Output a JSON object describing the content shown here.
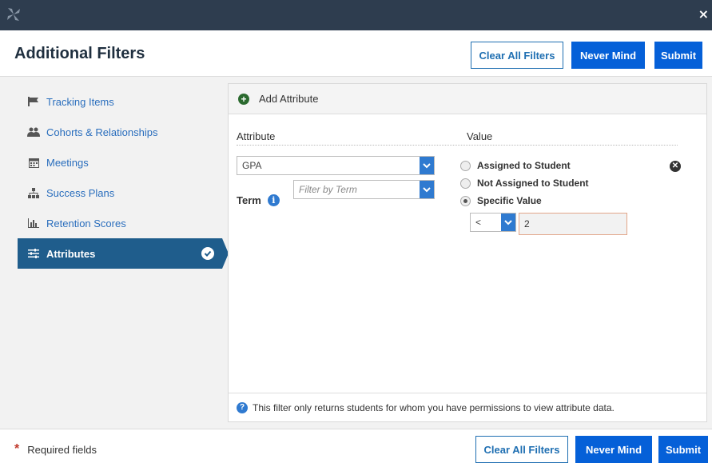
{
  "topbar": {
    "logo_icon": "pinwheel-logo-icon",
    "close_label": "×"
  },
  "header": {
    "title": "Additional Filters",
    "clear_label": "Clear All Filters",
    "nevermind_label": "Never Mind",
    "submit_label": "Submit"
  },
  "sidebar": {
    "items": [
      {
        "label": "Tracking Items",
        "icon": "flag-icon"
      },
      {
        "label": "Cohorts & Relationships",
        "icon": "users-icon"
      },
      {
        "label": "Meetings",
        "icon": "calendar-icon"
      },
      {
        "label": "Success Plans",
        "icon": "sitemap-icon"
      },
      {
        "label": "Retention Scores",
        "icon": "bar-chart-icon"
      },
      {
        "label": "Attributes",
        "icon": "sliders-icon",
        "active": true
      }
    ]
  },
  "panel": {
    "add_label": "Add Attribute",
    "attribute_header": "Attribute",
    "value_header": "Value",
    "attribute_value": "GPA",
    "term_label": "Term",
    "term_placeholder": "Filter by Term",
    "options": [
      "Assigned to Student",
      "Not Assigned to Student",
      "Specific Value"
    ],
    "selected_option": "Specific Value",
    "operator": "<",
    "value_input": "2",
    "note": "This filter only returns students for whom you have permissions to view attribute data."
  },
  "footer": {
    "required_label": "Required fields",
    "clear_label": "Clear All Filters",
    "nevermind_label": "Never Mind",
    "submit_label": "Submit"
  },
  "colors": {
    "accent": "#0560d8",
    "active_nav": "#1f5d8c",
    "topbar": "#2e3d4f"
  }
}
